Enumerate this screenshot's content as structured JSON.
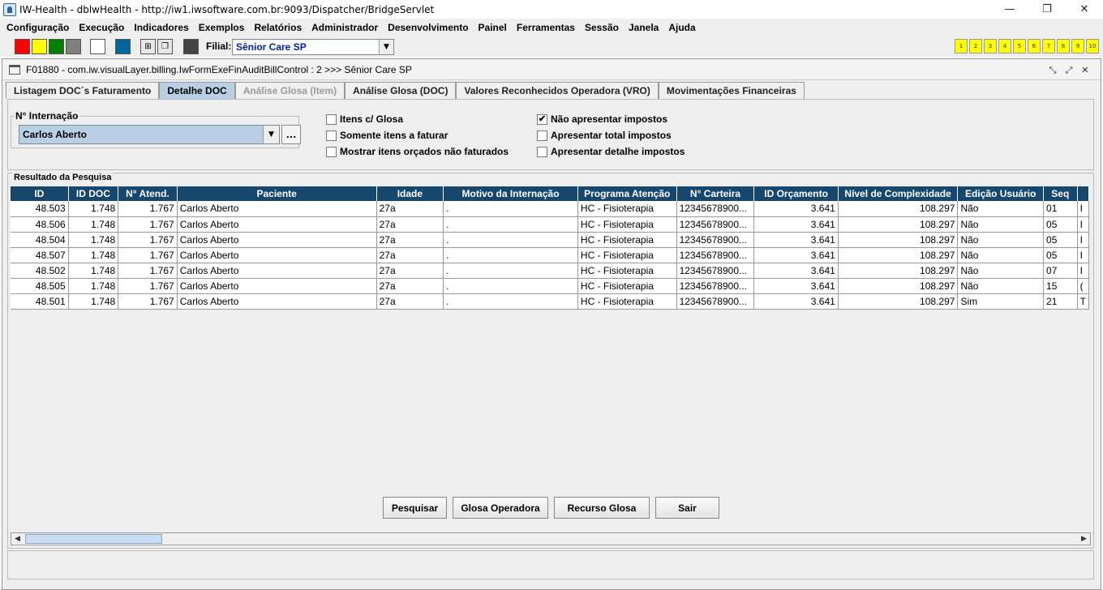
{
  "window": {
    "title": "IW-Health - dblwHealth - http://iw1.iwsoftware.com.br:9093/Dispatcher/BridgeServlet",
    "minimize": "—",
    "restore": "❐",
    "close": "✕"
  },
  "menu": [
    "Configuração",
    "Execução",
    "Indicadores",
    "Exemplos",
    "Relatórios",
    "Administrador",
    "Desenvolvimento",
    "Painel",
    "Ferramentas",
    "Sessão",
    "Janela",
    "Ajuda"
  ],
  "toolbar": {
    "swatches": [
      "#ff0000",
      "#ffff00",
      "#008000",
      "#808080",
      "#ffffff",
      "#006699",
      "#444444"
    ],
    "filial_label": "Filial:",
    "filial_value": "Sênior Care SP",
    "numbered_buttons": [
      "1",
      "2",
      "3",
      "4",
      "5",
      "6",
      "7",
      "8",
      "9",
      "10"
    ]
  },
  "internal_window": {
    "title": "F01880 - com.iw.visualLayer.billing.IwFormExeFinAuditBillControl : 2 >>> Sênior Care SP"
  },
  "tabs": [
    {
      "label": "Listagem DOC´s Faturamento",
      "state": "normal"
    },
    {
      "label": "Detalhe DOC",
      "state": "active"
    },
    {
      "label": "Análise Glosa (Item)",
      "state": "disabled"
    },
    {
      "label": "Análise Glosa (DOC)",
      "state": "normal"
    },
    {
      "label": "Valores Reconhecidos Operadora (VRO)",
      "state": "normal"
    },
    {
      "label": "Movimentações Financeiras",
      "state": "normal"
    }
  ],
  "filters": {
    "internacao_label": "N° Internação",
    "internacao_value": "Carlos Aberto",
    "ellipsis": "...",
    "checkboxes": [
      {
        "label": "Itens c/ Glosa",
        "checked": false
      },
      {
        "label": "Somente itens a faturar",
        "checked": false
      },
      {
        "label": "Mostrar itens orçados não faturados",
        "checked": false
      },
      {
        "label": "Não apresentar impostos",
        "checked": true
      },
      {
        "label": "Apresentar total impostos",
        "checked": false
      },
      {
        "label": "Apresentar detalhe impostos",
        "checked": false
      }
    ]
  },
  "results": {
    "legend": "Resultado da Pesquisa",
    "columns": [
      "ID",
      "ID DOC",
      "N° Atend.",
      "Paciente",
      "Idade",
      "Motivo da Internação",
      "Programa Atenção",
      "N° Carteira",
      "ID Orçamento",
      "Nível de Complexidade",
      "Edição Usuário",
      "Seq",
      ""
    ],
    "rows": [
      [
        "48.503",
        "1.748",
        "1.767",
        "Carlos Aberto",
        "27a",
        ".",
        "HC - Fisioterapia",
        "12345678900...",
        "3.641",
        "108.297",
        "Não",
        "01",
        "I"
      ],
      [
        "48.506",
        "1.748",
        "1.767",
        "Carlos Aberto",
        "27a",
        ".",
        "HC - Fisioterapia",
        "12345678900...",
        "3.641",
        "108.297",
        "Não",
        "05",
        "I"
      ],
      [
        "48.504",
        "1.748",
        "1.767",
        "Carlos Aberto",
        "27a",
        ".",
        "HC - Fisioterapia",
        "12345678900...",
        "3.641",
        "108.297",
        "Não",
        "05",
        "I"
      ],
      [
        "48.507",
        "1.748",
        "1.767",
        "Carlos Aberto",
        "27a",
        ".",
        "HC - Fisioterapia",
        "12345678900...",
        "3.641",
        "108.297",
        "Não",
        "05",
        "I"
      ],
      [
        "48.502",
        "1.748",
        "1.767",
        "Carlos Aberto",
        "27a",
        ".",
        "HC - Fisioterapia",
        "12345678900...",
        "3.641",
        "108.297",
        "Não",
        "07",
        "I"
      ],
      [
        "48.505",
        "1.748",
        "1.767",
        "Carlos Aberto",
        "27a",
        ".",
        "HC - Fisioterapia",
        "12345678900...",
        "3.641",
        "108.297",
        "Não",
        "15",
        "("
      ],
      [
        "48.501",
        "1.748",
        "1.767",
        "Carlos Aberto",
        "27a",
        ".",
        "HC - Fisioterapia",
        "12345678900...",
        "3.641",
        "108.297",
        "Sim",
        "21",
        "T"
      ]
    ]
  },
  "buttons": {
    "pesquisar": "Pesquisar",
    "glosa_operadora": "Glosa Operadora",
    "recurso_glosa": "Recurso Glosa",
    "sair": "Sair"
  }
}
